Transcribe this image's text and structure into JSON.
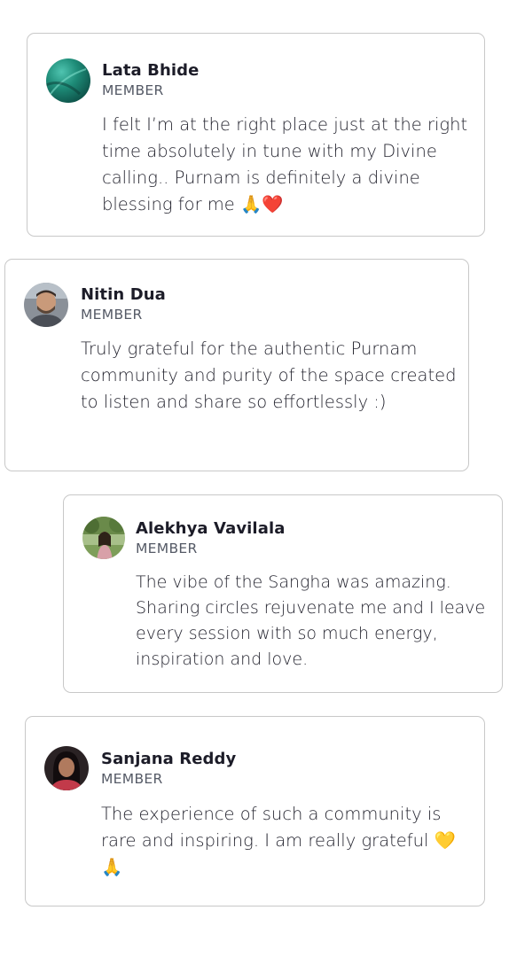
{
  "testimonials": [
    {
      "name": "Lata Bhide",
      "role": "MEMBER",
      "quote": "I felt I’m at the right place just at the right time absolutely in tune with my Divine calling.. Purnam is definitely a divine blessing for me 🙏❤️",
      "avatar_icon": "avatar-lata-bhide"
    },
    {
      "name": "Nitin Dua",
      "role": "MEMBER",
      "quote": "Truly grateful for the authentic Purnam community and purity of the space created to listen and share so effortlessly :)",
      "avatar_icon": "avatar-nitin-dua"
    },
    {
      "name": "Alekhya Vavilala",
      "role": "MEMBER",
      "quote": "The vibe of the Sangha was amazing. Sharing circles rejuvenate me and I leave every session with so much energy, inspiration and love.",
      "avatar_icon": "avatar-alekhya-vavilala"
    },
    {
      "name": "Sanjana Reddy",
      "role": "MEMBER",
      "quote": "The experience of such a community is rare and inspiring. I am really grateful 💛🙏",
      "avatar_icon": "avatar-sanjana-reddy"
    }
  ],
  "colors": {
    "card_border": "#c8c8c8",
    "name_text": "#1c1c28",
    "role_text": "#555a66",
    "quote_text": "#23232e"
  }
}
